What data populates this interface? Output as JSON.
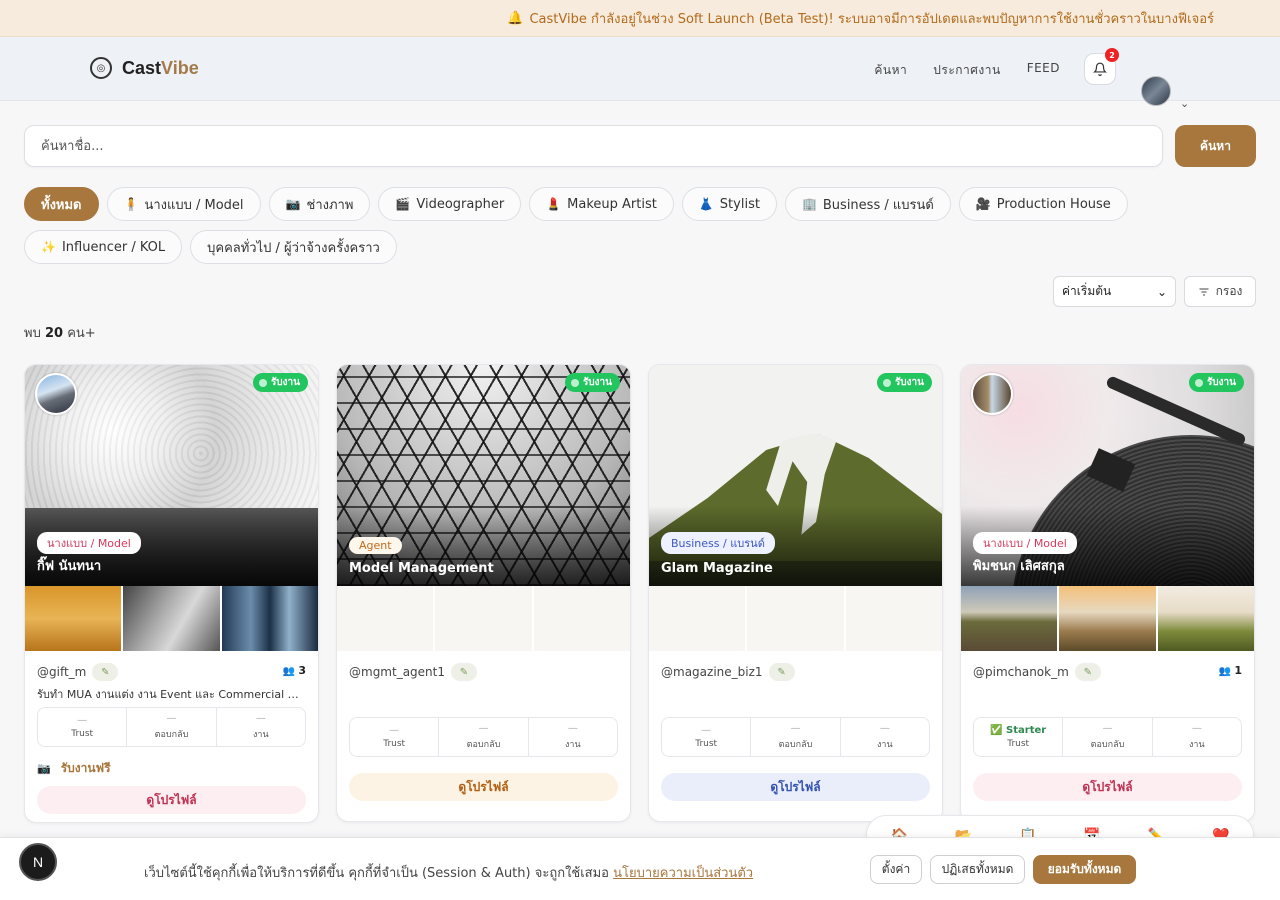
{
  "announcement": {
    "icon": "bell-icon",
    "text": "CastVibe กำลังอยู่ในช่วง Soft Launch (Beta Test)! ระบบอาจมีการอัปเดตและพบปัญหาการใช้งานชั่วคราวในบางฟีเจอร์"
  },
  "header": {
    "brand_cast": "Cast",
    "brand_vibe": "Vibe",
    "nav": [
      "ค้นหา",
      "ประกาศงาน",
      "FEED"
    ],
    "notification_count": "2"
  },
  "search": {
    "placeholder": "ค้นหาชื่อ...",
    "button": "ค้นหา"
  },
  "categories": [
    {
      "label": "ทั้งหมด",
      "icon": ""
    },
    {
      "label": "นางแบบ / Model",
      "icon": "🧍"
    },
    {
      "label": "ช่างภาพ",
      "icon": "📷"
    },
    {
      "label": "Videographer",
      "icon": "🎬"
    },
    {
      "label": "Makeup Artist",
      "icon": "💄"
    },
    {
      "label": "Stylist",
      "icon": "👗"
    },
    {
      "label": "Business / แบรนด์",
      "icon": "🏢"
    },
    {
      "label": "Production House",
      "icon": "🎥"
    },
    {
      "label": "Influencer / KOL",
      "icon": "✨"
    },
    {
      "label": "บุคคลทั่วไป / ผู้ว่าจ้างครั้งคราว",
      "icon": ""
    }
  ],
  "sort": {
    "selected": "ค่าเริ่มต้น",
    "filter": "กรอง"
  },
  "results": {
    "prefix": "พบ",
    "count": "20",
    "suffix": "คน+"
  },
  "cards": [
    {
      "status": "รับงาน",
      "tag": "นางแบบ / Model",
      "name": "กิ๊ฟ นันทนา",
      "handle": "@gift_m",
      "followers": "3",
      "bio": "รับทำ MUA งานแต่ง งาน Event และ Commercial — ทีมงานมืออาชีพ",
      "trust": "—",
      "reply": "—",
      "jobs": "—",
      "free": "รับงานฟรี",
      "profile": "ดูโปรไฟล์"
    },
    {
      "status": "รับงาน",
      "tag": "Agent",
      "name": "Model Management",
      "handle": "@mgmt_agent1",
      "trust": "—",
      "reply": "—",
      "jobs": "—",
      "profile": "ดูโปรไฟล์"
    },
    {
      "status": "รับงาน",
      "tag": "Business / แบรนด์",
      "name": "Glam Magazine",
      "handle": "@magazine_biz1",
      "trust": "—",
      "reply": "—",
      "jobs": "—",
      "profile": "ดูโปรไฟล์"
    },
    {
      "status": "รับงาน",
      "tag": "นางแบบ / Model",
      "name": "พิมชนก เลิศสกุล",
      "handle": "@pimchanok_m",
      "followers": "1",
      "trust_badge": "Starter",
      "trust": "—",
      "reply": "—",
      "jobs": "—",
      "profile": "ดูโปรไฟล์"
    }
  ],
  "stat_labels": {
    "trust": "Trust",
    "reply": "ตอบกลับ",
    "jobs": "งาน"
  },
  "cookie": {
    "text": "เว็บไซต์นี้ใช้คุกกี้เพื่อให้บริการที่ดีขึ้น คุกกี้ที่จำเป็น (Session & Auth) จะถูกใช้เสมอ",
    "link": "นโยบายความเป็นส่วนตัว",
    "settings": "ตั้งค่า",
    "reject": "ปฏิเสธทั้งหมด",
    "accept": "ยอมรับทั้งหมด"
  },
  "dev_badge": "N"
}
